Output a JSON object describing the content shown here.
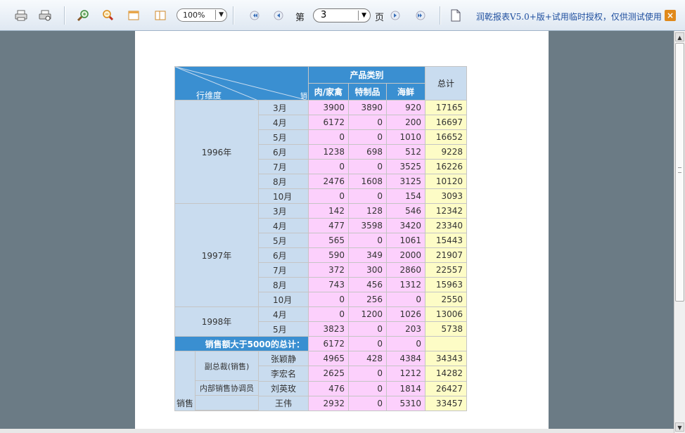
{
  "toolbar": {
    "zoom": "100%",
    "page_label_prefix": "第",
    "page_current": "3",
    "page_label_suffix": "页",
    "license_text": "润乾报表V5.0+版+试用临时授权，仅供测试使用",
    "close_glyph": "×",
    "icons": [
      "print-icon",
      "print-preview-icon",
      "zoom-in-icon",
      "zoom-out-icon",
      "export-icon",
      "layout-icon",
      "first-page-icon",
      "prev-page-icon",
      "next-page-icon",
      "last-page-icon",
      "save-doc-icon",
      "close-icon"
    ]
  },
  "report": {
    "header": {
      "corner_row_label": "行维度",
      "corner_col_label": "销",
      "group_label": "产品类别",
      "categories": [
        "肉/家禽",
        "特制品",
        "海鲜"
      ],
      "total_label": "总计"
    },
    "year_groups": [
      {
        "year": "1996年",
        "rows": [
          {
            "month": "3月",
            "v": [
              "3900",
              "3890",
              "920"
            ],
            "total": "17165"
          },
          {
            "month": "4月",
            "v": [
              "6172",
              "0",
              "200"
            ],
            "total": "16697"
          },
          {
            "month": "5月",
            "v": [
              "0",
              "0",
              "1010"
            ],
            "total": "16652"
          },
          {
            "month": "6月",
            "v": [
              "1238",
              "698",
              "512"
            ],
            "total": "9228"
          },
          {
            "month": "7月",
            "v": [
              "0",
              "0",
              "3525"
            ],
            "total": "16226"
          },
          {
            "month": "8月",
            "v": [
              "2476",
              "1608",
              "3125"
            ],
            "total": "10120"
          },
          {
            "month": "10月",
            "v": [
              "0",
              "0",
              "154"
            ],
            "total": "3093"
          }
        ]
      },
      {
        "year": "1997年",
        "rows": [
          {
            "month": "3月",
            "v": [
              "142",
              "128",
              "546"
            ],
            "total": "12342"
          },
          {
            "month": "4月",
            "v": [
              "477",
              "3598",
              "3420"
            ],
            "total": "23340"
          },
          {
            "month": "5月",
            "v": [
              "565",
              "0",
              "1061"
            ],
            "total": "15443"
          },
          {
            "month": "6月",
            "v": [
              "590",
              "349",
              "2000"
            ],
            "total": "21907"
          },
          {
            "month": "7月",
            "v": [
              "372",
              "300",
              "2860"
            ],
            "total": "22557"
          },
          {
            "month": "8月",
            "v": [
              "743",
              "456",
              "1312"
            ],
            "total": "15963"
          },
          {
            "month": "10月",
            "v": [
              "0",
              "256",
              "0"
            ],
            "total": "2550"
          }
        ]
      },
      {
        "year": "1998年",
        "rows": [
          {
            "month": "4月",
            "v": [
              "0",
              "1200",
              "1026"
            ],
            "total": "13006"
          },
          {
            "month": "5月",
            "v": [
              "3823",
              "0",
              "203"
            ],
            "total": "5738"
          }
        ]
      }
    ],
    "summary": {
      "label": "销售额大于5000的总计：",
      "v": [
        "6172",
        "0",
        "0"
      ],
      "total": ""
    },
    "dept_label": "销售",
    "employees": [
      {
        "title": "副总裁(销售)",
        "name": "张颖静",
        "v": [
          "4965",
          "428",
          "4384"
        ],
        "total": "34343"
      },
      {
        "title": "",
        "name": "李宏名",
        "v": [
          "2625",
          "0",
          "1212"
        ],
        "total": "14282"
      },
      {
        "title": "内部销售协调员",
        "name": "刘英玫",
        "v": [
          "476",
          "0",
          "1814"
        ],
        "total": "26427"
      },
      {
        "title": "",
        "name": "王伟",
        "v": [
          "2932",
          "0",
          "5310"
        ],
        "total": "33457"
      }
    ]
  }
}
